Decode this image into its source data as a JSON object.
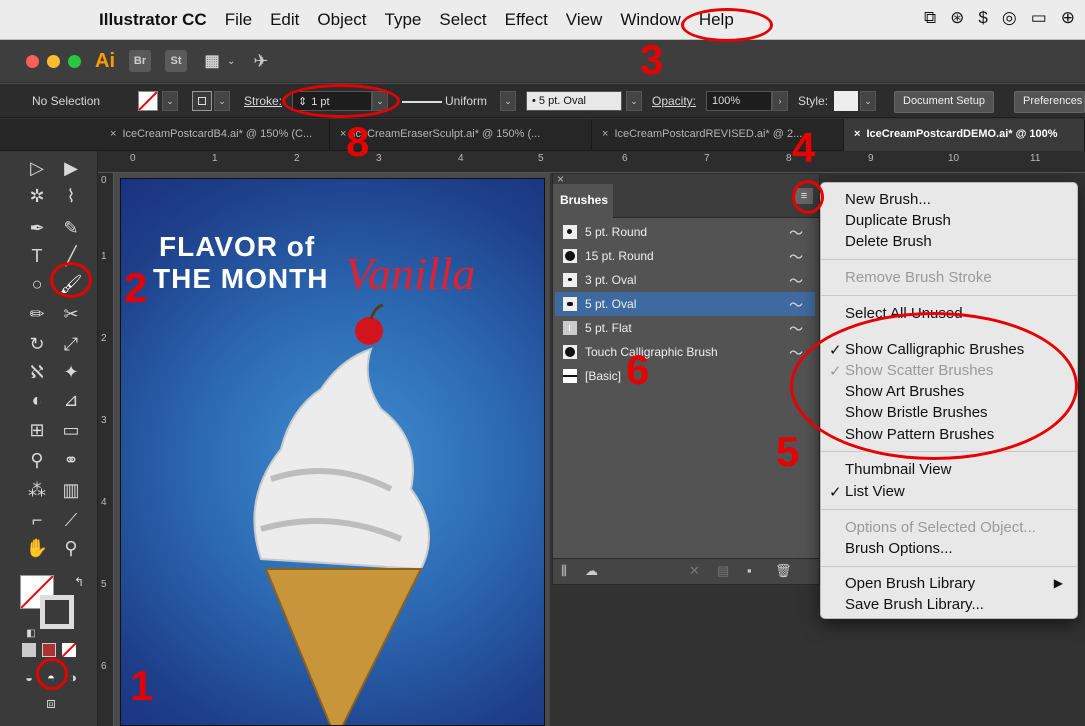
{
  "menubar": {
    "app_name": "Illustrator CC",
    "items": [
      "File",
      "Edit",
      "Object",
      "Type",
      "Select",
      "Effect",
      "View",
      "Window",
      "Help"
    ]
  },
  "appbar": {
    "logo": "Ai",
    "br": "Br",
    "st": "St"
  },
  "control_bar": {
    "selection": "No Selection",
    "stroke_label": "Stroke:",
    "stroke_value": "1 pt",
    "profile": "Uniform",
    "brush": "5 pt. Oval",
    "opacity_label": "Opacity:",
    "opacity_value": "100%",
    "style_label": "Style:",
    "doc_setup": "Document Setup",
    "preferences": "Preferences"
  },
  "tabs": [
    {
      "label": "IceCreamPostcardB4.ai* @ 150% (C..."
    },
    {
      "label": "IceCreamEraserSculpt.ai* @ 150% (..."
    },
    {
      "label": "IceCreamPostcardREVISED.ai* @ 2..."
    },
    {
      "label": "IceCreamPostcardDEMO.ai* @ 100%"
    }
  ],
  "ruler": {
    "h": [
      "0",
      "1",
      "2",
      "3",
      "4",
      "5",
      "6",
      "7",
      "8",
      "9",
      "10",
      "11"
    ],
    "v": [
      "0",
      "1",
      "2",
      "3",
      "4",
      "5",
      "6"
    ]
  },
  "artwork": {
    "line1": "FLAVOR of",
    "line2": "THE MONTH",
    "script": "Vanilla"
  },
  "brushes_panel": {
    "title": "Brushes",
    "items": [
      {
        "label": "5 pt. Round"
      },
      {
        "label": "15 pt. Round"
      },
      {
        "label": "3 pt. Oval"
      },
      {
        "label": "5 pt. Oval"
      },
      {
        "label": "5 pt. Flat"
      },
      {
        "label": "Touch Calligraphic Brush"
      },
      {
        "label": "[Basic]"
      }
    ]
  },
  "flyout_menu": {
    "new_brush": "New Brush...",
    "duplicate": "Duplicate Brush",
    "delete": "Delete Brush",
    "remove_stroke": "Remove Brush Stroke",
    "select_unused": "Select All Unused",
    "show_calligraphic": "Show Calligraphic Brushes",
    "show_scatter": "Show Scatter Brushes",
    "show_art": "Show Art Brushes",
    "show_bristle": "Show Bristle Brushes",
    "show_pattern": "Show Pattern Brushes",
    "thumbnail_view": "Thumbnail View",
    "list_view": "List View",
    "options_selected": "Options of Selected Object...",
    "brush_options": "Brush Options...",
    "open_library": "Open Brush Library",
    "save_library": "Save Brush Library..."
  },
  "annotations": [
    "1",
    "2",
    "3",
    "4",
    "5",
    "6",
    "8"
  ],
  "colors": {
    "annotation": "#e60000",
    "selected_row": "#3f6aa0",
    "logo": "#ff9a00"
  }
}
